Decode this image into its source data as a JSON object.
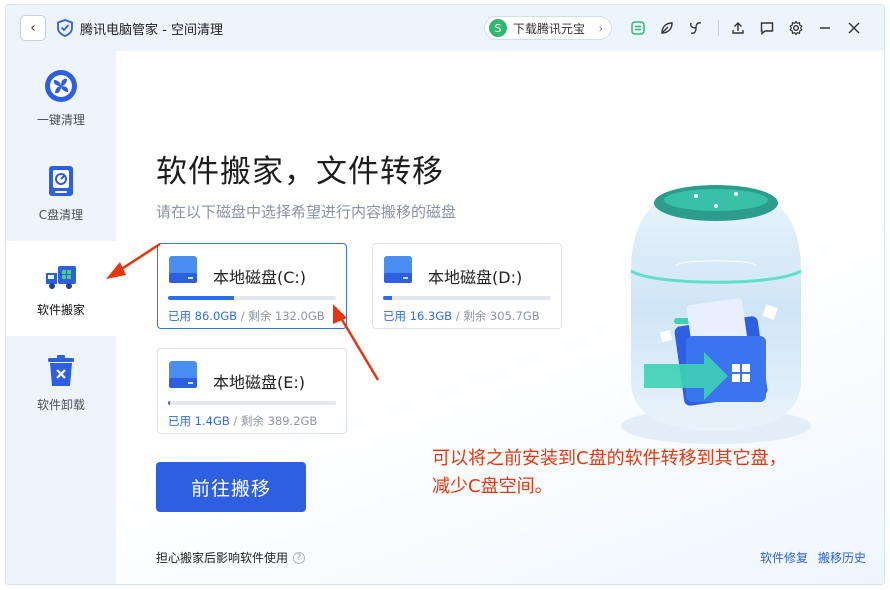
{
  "titlebar": {
    "title": "腾讯电脑管家 - 空间清理",
    "promo_label": "下载腾讯元宝",
    "icons": [
      "back-icon",
      "shield-logo-icon",
      "yuanbao-icon",
      "badge-icon",
      "leaf-icon",
      "fan-icon",
      "upload-icon",
      "message-icon",
      "gear-icon",
      "minimize-icon",
      "close-icon"
    ]
  },
  "sidebar": {
    "items": [
      {
        "label": "一键清理",
        "icon": "fan-icon",
        "active": false
      },
      {
        "label": "C盘清理",
        "icon": "disk-c-icon",
        "active": false
      },
      {
        "label": "软件搬家",
        "icon": "truck-icon",
        "active": true
      },
      {
        "label": "软件卸载",
        "icon": "trash-icon",
        "active": false
      }
    ]
  },
  "main": {
    "heading": "软件搬家，文件转移",
    "subheading": "请在以下磁盘中选择希望进行内容搬移的磁盘",
    "disks": [
      {
        "name": "本地磁盘(C:)",
        "used_label": "已用 86.0GB",
        "sep": " / ",
        "free_label": "剩余 132.0GB",
        "usage": 0.394,
        "selected": true
      },
      {
        "name": "本地磁盘(D:)",
        "used_label": "已用 16.3GB",
        "sep": " / ",
        "free_label": "剩余 305.7GB",
        "usage": 0.051,
        "selected": false
      },
      {
        "name": "本地磁盘(E:)",
        "used_label": "已用 1.4GB",
        "sep": " / ",
        "free_label": "剩余 389.2GB",
        "usage": 0.004,
        "selected": false
      }
    ],
    "go_button": "前往搬移",
    "worry_text": "担心搬家后影响软件使用",
    "worry_icon": "?",
    "links": [
      "软件修复",
      "搬移历史"
    ]
  },
  "annotation": {
    "line1": "可以将之前安装到C盘的软件转移到其它盘，",
    "line2": "减少C盘空间。",
    "color": "#e8360f"
  },
  "colors": {
    "accent": "#2e5fe0",
    "annotation": "#e8360f"
  }
}
